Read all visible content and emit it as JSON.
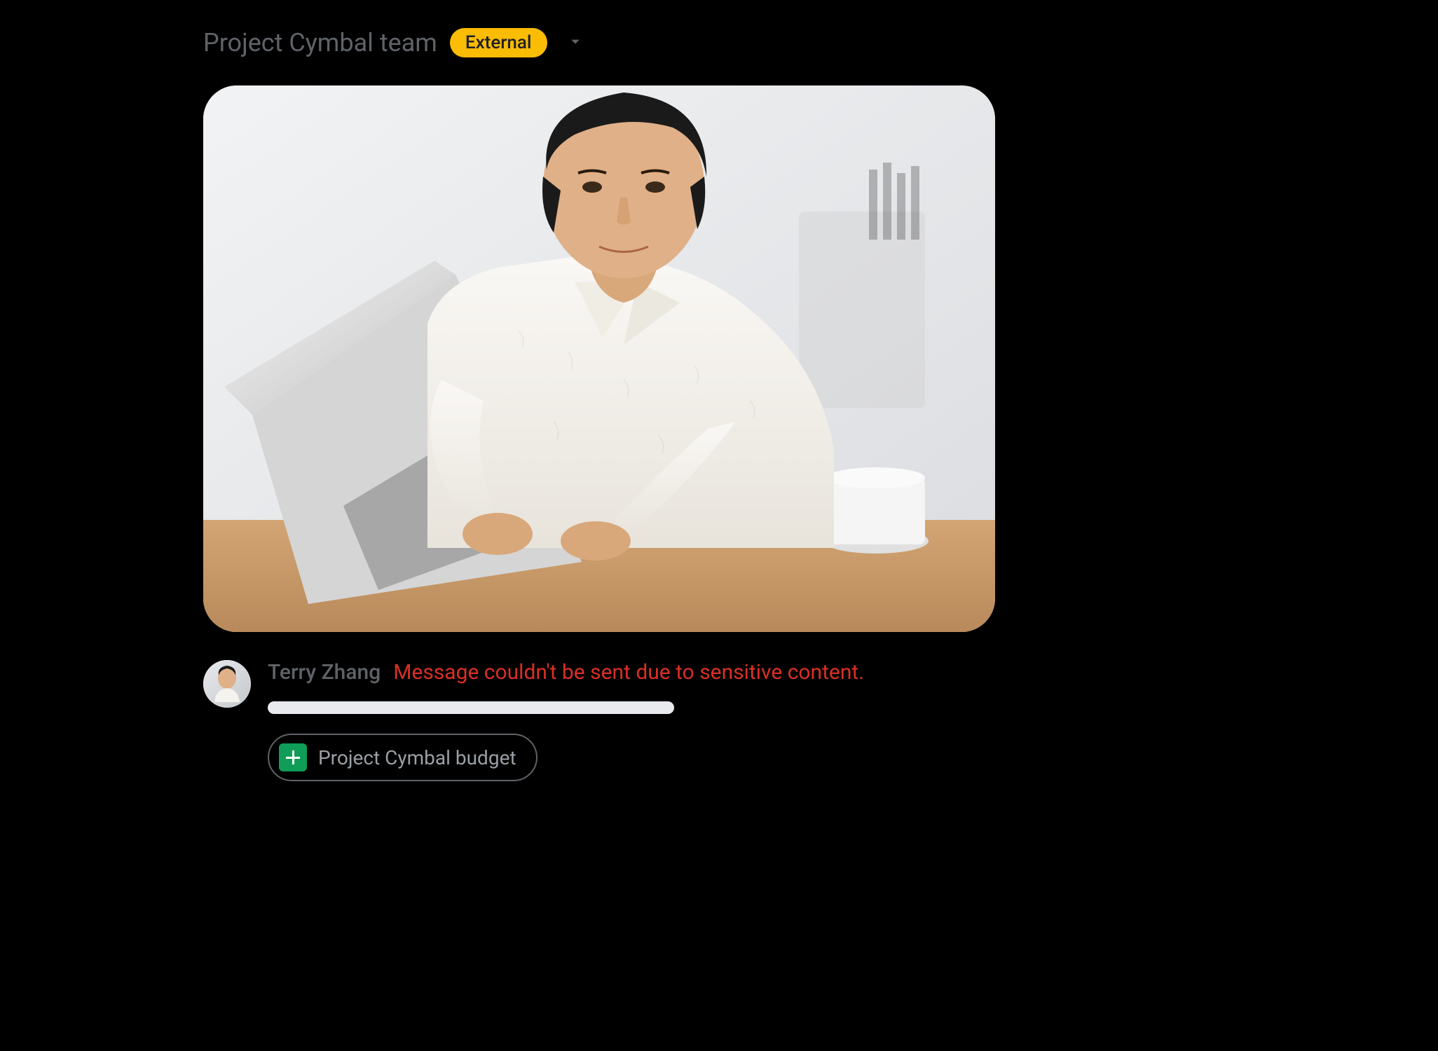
{
  "header": {
    "space_title": "Project Cymbal team",
    "badge_label": "External"
  },
  "message": {
    "sender_name": "Terry Zhang",
    "error_text": "Message couldn't be sent due to sensitive content.",
    "attachment": {
      "name": "Project Cymbal budget",
      "type": "google-sheets"
    }
  },
  "colors": {
    "badge_bg": "#fbbc04",
    "error": "#d93025",
    "sheets_green": "#0f9d58",
    "text_secondary": "#5f6368"
  }
}
